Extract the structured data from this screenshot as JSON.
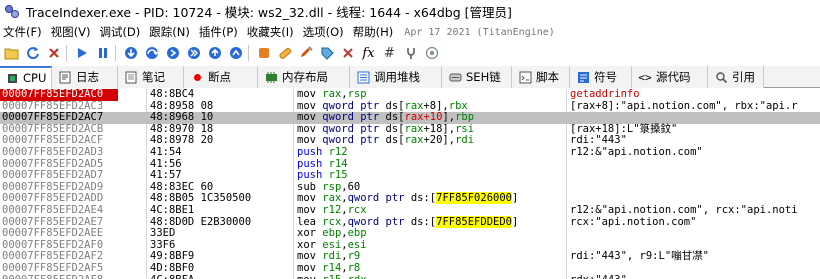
{
  "window": {
    "title": "TraceIndexer.exe - PID: 10724 - 模块: ws2_32.dll - 线程: 1644 - x64dbg [管理员]"
  },
  "menu": {
    "items": [
      "文件(F)",
      "视图(V)",
      "调试(D)",
      "跟踪(N)",
      "插件(P)",
      "收藏夹(I)",
      "选项(O)",
      "帮助(H)"
    ],
    "date": "Apr 17 2021 (TitanEngine)"
  },
  "toolbar": {
    "icons": [
      "open-icon",
      "restart-icon",
      "close-icon",
      "run-icon",
      "pause-icon",
      "step-into-icon",
      "step-over-icon",
      "trace-into-icon",
      "trace-over-icon",
      "execute-till-return-icon",
      "run-to-user-code-icon",
      "scylla-icon",
      "patch-icon",
      "comment-icon",
      "label-icon",
      "bookmark-icon",
      "function-icon",
      "hash-icon",
      "attach-icon",
      "about-icon"
    ]
  },
  "tabs": [
    {
      "label": "CPU",
      "icon": "cpu-icon",
      "active": true
    },
    {
      "label": "日志",
      "icon": "log-icon",
      "active": false
    },
    {
      "label": "笔记",
      "icon": "notes-icon",
      "active": false
    },
    {
      "label": "断点",
      "icon": "breakpoint-icon",
      "active": false
    },
    {
      "label": "内存布局",
      "icon": "memory-map-icon",
      "active": false
    },
    {
      "label": "调用堆栈",
      "icon": "call-stack-icon",
      "active": false
    },
    {
      "label": "SEH链",
      "icon": "seh-icon",
      "active": false
    },
    {
      "label": "脚本",
      "icon": "script-icon",
      "active": false
    },
    {
      "label": "符号",
      "icon": "symbols-icon",
      "active": false
    },
    {
      "label": "源代码",
      "icon": "source-icon",
      "active": false
    },
    {
      "label": "引用",
      "icon": "references-icon",
      "active": false
    }
  ],
  "colors": {
    "rip_bg": "#d20000",
    "selected_row": "#c0c0c0",
    "push_color": "#0000ff",
    "register_color": "#008000",
    "highlight": "#ffff00",
    "tab_accent": "#3c78d8"
  },
  "disasm": {
    "rows": [
      {
        "addr": "00007FF85EFD2AC0",
        "bytes": "48:8BC4",
        "instr": [
          [
            "mn-mov",
            "mov "
          ],
          [
            "reg",
            "rax"
          ],
          [
            "",
            ","
          ],
          [
            "reg",
            "rsp"
          ]
        ],
        "comment": "getaddrinfo",
        "comment_red": true,
        "addr_style": "rip",
        "sel": false
      },
      {
        "addr": "00007FF85EFD2AC3",
        "bytes": "48:8958 08",
        "instr": [
          [
            "mn-mov",
            "mov "
          ],
          [
            "kw",
            "qword ptr "
          ],
          [
            "seg",
            "ds"
          ],
          [
            "",
            "["
          ],
          [
            "reg",
            "rax"
          ],
          [
            "",
            "+8],"
          ],
          [
            "reg",
            "rbx"
          ]
        ],
        "comment": "[rax+8]:\"api.notion.com\", rbx:\"api.r",
        "comment_red": false,
        "addr_style": "",
        "sel": false
      },
      {
        "addr": "00007FF85EFD2AC7",
        "bytes": "48:8968 10",
        "instr": [
          [
            "mn-mov",
            "mov "
          ],
          [
            "kw",
            "qword ptr "
          ],
          [
            "seg",
            "ds"
          ],
          [
            "",
            "["
          ],
          [
            "reg red",
            "rax+10"
          ],
          [
            "",
            "],"
          ],
          [
            "reg",
            "rbp"
          ]
        ],
        "comment": "",
        "comment_red": false,
        "addr_style": "cur",
        "sel": true
      },
      {
        "addr": "00007FF85EFD2ACB",
        "bytes": "48:8970 18",
        "instr": [
          [
            "mn-mov",
            "mov "
          ],
          [
            "kw",
            "qword ptr "
          ],
          [
            "seg",
            "ds"
          ],
          [
            "",
            "["
          ],
          [
            "reg",
            "rax"
          ],
          [
            "",
            "+18],"
          ],
          [
            "reg",
            "rsi"
          ]
        ],
        "comment": "[rax+18]:L\"箓搡鈫\"",
        "comment_red": false,
        "addr_style": "",
        "sel": false
      },
      {
        "addr": "00007FF85EFD2ACF",
        "bytes": "48:8978 20",
        "instr": [
          [
            "mn-mov",
            "mov "
          ],
          [
            "kw",
            "qword ptr "
          ],
          [
            "seg",
            "ds"
          ],
          [
            "",
            "["
          ],
          [
            "reg",
            "rax"
          ],
          [
            "",
            "+20],"
          ],
          [
            "reg",
            "rdi"
          ]
        ],
        "comment": "rdi:\"443\"",
        "comment_red": false,
        "addr_style": "",
        "sel": false
      },
      {
        "addr": "00007FF85EFD2AD3",
        "bytes": "41:54",
        "instr": [
          [
            "mn-push",
            "push "
          ],
          [
            "reg",
            "r12"
          ]
        ],
        "comment": "r12:&\"api.notion.com\"",
        "comment_red": false,
        "addr_style": "",
        "sel": false
      },
      {
        "addr": "00007FF85EFD2AD5",
        "bytes": "41:56",
        "instr": [
          [
            "mn-push",
            "push "
          ],
          [
            "reg",
            "r14"
          ]
        ],
        "comment": "",
        "comment_red": false,
        "addr_style": "",
        "sel": false
      },
      {
        "addr": "00007FF85EFD2AD7",
        "bytes": "41:57",
        "instr": [
          [
            "mn-push",
            "push "
          ],
          [
            "reg",
            "r15"
          ]
        ],
        "comment": "",
        "comment_red": false,
        "addr_style": "",
        "sel": false
      },
      {
        "addr": "00007FF85EFD2AD9",
        "bytes": "48:83EC 60",
        "instr": [
          [
            "mn-sub",
            "sub "
          ],
          [
            "reg",
            "rsp"
          ],
          [
            "",
            ","
          ],
          [
            "num",
            "60"
          ]
        ],
        "comment": "",
        "comment_red": false,
        "addr_style": "",
        "sel": false
      },
      {
        "addr": "00007FF85EFD2ADD",
        "bytes": "48:8B05 1C350500",
        "instr": [
          [
            "mn-mov",
            "mov "
          ],
          [
            "reg",
            "rax"
          ],
          [
            "",
            ","
          ],
          [
            "kw",
            "qword ptr "
          ],
          [
            "seg",
            "ds"
          ],
          [
            "",
            ":["
          ],
          [
            "hl-yellow",
            "7FF85F026000"
          ],
          [
            "",
            "]"
          ]
        ],
        "comment": "",
        "comment_red": false,
        "addr_style": "",
        "sel": false
      },
      {
        "addr": "00007FF85EFD2AE4",
        "bytes": "4C:8BE1",
        "instr": [
          [
            "mn-mov",
            "mov "
          ],
          [
            "reg",
            "r12"
          ],
          [
            "",
            ","
          ],
          [
            "reg",
            "rcx"
          ]
        ],
        "comment": "r12:&\"api.notion.com\", rcx:\"api.noti",
        "comment_red": false,
        "addr_style": "",
        "sel": false
      },
      {
        "addr": "00007FF85EFD2AE7",
        "bytes": "48:8D0D E2B30000",
        "instr": [
          [
            "mn-mov",
            "lea "
          ],
          [
            "reg",
            "rcx"
          ],
          [
            "",
            ","
          ],
          [
            "kw",
            "qword ptr "
          ],
          [
            "seg",
            "ds"
          ],
          [
            "",
            ":["
          ],
          [
            "hl-yellow",
            "7FF85EFDDED0"
          ],
          [
            "",
            "]"
          ]
        ],
        "comment": "rcx:\"api.notion.com\"",
        "comment_red": false,
        "addr_style": "",
        "sel": false
      },
      {
        "addr": "00007FF85EFD2AEE",
        "bytes": "33ED",
        "instr": [
          [
            "mn-xor",
            "xor "
          ],
          [
            "reg",
            "ebp"
          ],
          [
            "",
            ","
          ],
          [
            "reg",
            "ebp"
          ]
        ],
        "comment": "",
        "comment_red": false,
        "addr_style": "",
        "sel": false
      },
      {
        "addr": "00007FF85EFD2AF0",
        "bytes": "33F6",
        "instr": [
          [
            "mn-xor",
            "xor "
          ],
          [
            "reg",
            "esi"
          ],
          [
            "",
            ","
          ],
          [
            "reg",
            "esi"
          ]
        ],
        "comment": "",
        "comment_red": false,
        "addr_style": "",
        "sel": false
      },
      {
        "addr": "00007FF85EFD2AF2",
        "bytes": "49:8BF9",
        "instr": [
          [
            "mn-mov",
            "mov "
          ],
          [
            "reg",
            "rdi"
          ],
          [
            "",
            ","
          ],
          [
            "reg",
            "r9"
          ]
        ],
        "comment": "rdi:\"443\", r9:L\"嘣甘凚\"",
        "comment_red": false,
        "addr_style": "",
        "sel": false
      },
      {
        "addr": "00007FF85EFD2AF5",
        "bytes": "4D:8BF0",
        "instr": [
          [
            "mn-mov",
            "mov "
          ],
          [
            "reg",
            "r14"
          ],
          [
            "",
            ","
          ],
          [
            "reg",
            "r8"
          ]
        ],
        "comment": "",
        "comment_red": false,
        "addr_style": "",
        "sel": false
      },
      {
        "addr": "00007FF85EFD2AF8",
        "bytes": "4C:8BFA",
        "instr": [
          [
            "mn-mov",
            "mov "
          ],
          [
            "reg",
            "r15"
          ],
          [
            "",
            ","
          ],
          [
            "reg",
            "rdx"
          ]
        ],
        "comment": "rdx:\"443\"",
        "comment_red": false,
        "addr_style": "",
        "sel": false
      }
    ]
  }
}
